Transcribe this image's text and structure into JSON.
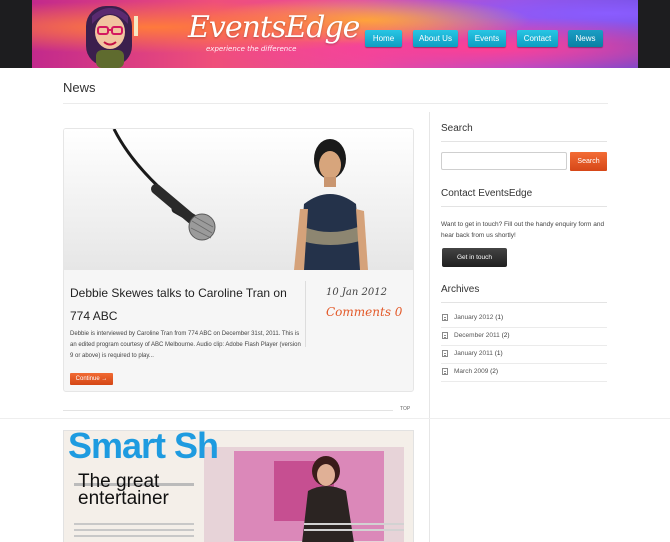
{
  "header": {
    "logo": "EventsEdge",
    "tagline": "experience the difference",
    "nav": [
      {
        "label": "Home"
      },
      {
        "label": "About Us"
      },
      {
        "label": "Events"
      },
      {
        "label": "Contact"
      },
      {
        "label": "News"
      }
    ]
  },
  "page": {
    "title": "News"
  },
  "posts": [
    {
      "title": "Debbie Skewes talks to Caroline Tran on 774 ABC",
      "date": "10 Jan 2012",
      "comments": "Comments 0",
      "excerpt": "Debbie is interviewed by Caroline Tran from 774 ABC on December 31st, 2011. This is an edited program courtesy of ABC Melbourne. Audio clip: Adobe Flash Player (version 9 or above) is required to play...",
      "continue_label": "Continue →"
    },
    {
      "headline1": "Smart Sh",
      "headline2": "The great entertainer"
    }
  ],
  "top_label": "TOP",
  "sidebar": {
    "search": {
      "heading": "Search",
      "placeholder": "",
      "button": "Search"
    },
    "contact": {
      "heading": "Contact EventsEdge",
      "text": "Want to get in touch? Fill out the handy enquiry form and hear back from us shortly!",
      "button": "Get in touch"
    },
    "archives": {
      "heading": "Archives",
      "items": [
        {
          "label": "January 2012",
          "count": " (1)"
        },
        {
          "label": "December 2011",
          "count": " (2)"
        },
        {
          "label": "January 2011",
          "count": " (1)"
        },
        {
          "label": "March 2009",
          "count": " (2)"
        }
      ]
    }
  },
  "colors": {
    "nav": "#14a8cc",
    "accent": "#e05122",
    "dark_button": "#2b2b2b"
  }
}
